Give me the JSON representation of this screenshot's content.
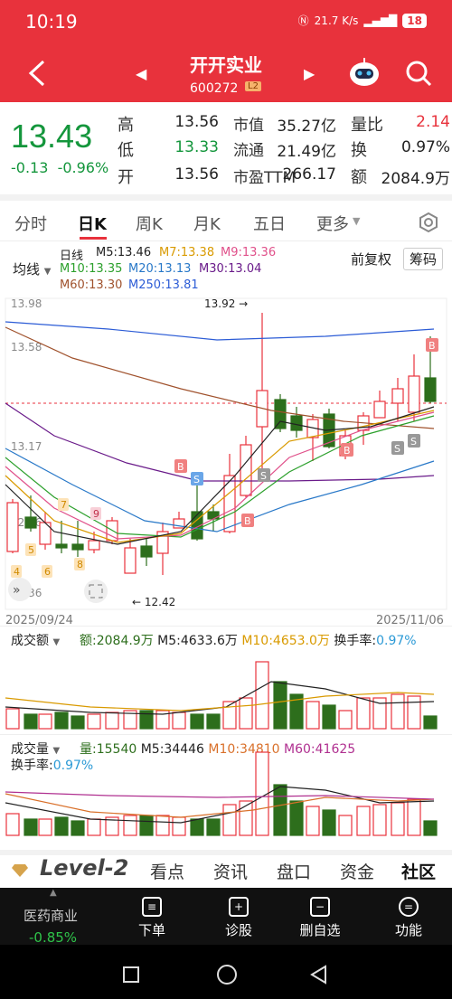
{
  "status_bar": {
    "time": "10:19",
    "net_speed": "21.7 K/s",
    "battery": "18"
  },
  "header": {
    "title": "开开实业",
    "code": "600272",
    "level_badge": "L2"
  },
  "quote": {
    "price": "13.43",
    "change": "-0.13",
    "change_pct": "-0.96%",
    "rows": [
      {
        "l1": "高",
        "v1": "13.56",
        "l2": "市值",
        "v2": "35.27亿",
        "l3": "量比",
        "v3": "2.14"
      },
      {
        "l1": "低",
        "v1": "13.33",
        "l2": "流通",
        "v2": "21.49亿",
        "l3": "换",
        "v3": "0.97%"
      },
      {
        "l1": "开",
        "v1": "13.56",
        "l2": "市盈TTM",
        "v2": "266.17",
        "l3": "额",
        "v3": "2084.9万"
      }
    ]
  },
  "tabs": [
    "分时",
    "日K",
    "周K",
    "月K",
    "五日",
    "更多"
  ],
  "active_tab": "日K",
  "ma_legend": {
    "selector": "均线",
    "period": "日线",
    "items": [
      {
        "text": "M5:13.46",
        "color": "#222222"
      },
      {
        "text": "M7:13.38",
        "color": "#d99a00"
      },
      {
        "text": "M9:13.36",
        "color": "#e0508a"
      },
      {
        "text": "M10:13.35",
        "color": "#2ca02c"
      },
      {
        "text": "M20:13.13",
        "color": "#2878c8"
      },
      {
        "text": "M30:13.04",
        "color": "#6a1b8a"
      },
      {
        "text": "M60:13.30",
        "color": "#a0522d"
      },
      {
        "text": "M250:13.81",
        "color": "#2c5cd6"
      }
    ],
    "adjust": "前复权",
    "chips": "筹码"
  },
  "kline": {
    "y_labels": [
      "13.98",
      "13.58",
      "13.17",
      "12.76",
      "12.36"
    ],
    "high_marker": "13.92",
    "low_marker": "12.42",
    "date_start": "2025/09/24",
    "date_end": "2025/11/06",
    "seq_markers": [
      "4",
      "5",
      "6",
      "7",
      "8",
      "9"
    ],
    "signals": [
      "B",
      "S",
      "B",
      "S",
      "B",
      "B",
      "S",
      "S"
    ]
  },
  "volume_amount": {
    "selector": "成交额",
    "amount": "额:2084.9万",
    "m5": "M5:4633.6万",
    "m10": "M10:4653.0万",
    "turnover_label": "换手率:",
    "turnover": "0.97%"
  },
  "volume_qty": {
    "selector": "成交量",
    "qty": "量:15540",
    "m5": "M5:34446",
    "m10": "M10:34810",
    "m60": "M60:41625",
    "turnover_label": "换手率:",
    "turnover": "0.97%"
  },
  "level2_bar": {
    "brand": "Level-2",
    "items": [
      "看点",
      "资讯",
      "盘口",
      "资金",
      "社区"
    ]
  },
  "bottom_nav": {
    "sector_name": "医药商业",
    "sector_change": "-0.85%",
    "items": [
      "下单",
      "诊股",
      "删自选",
      "功能"
    ]
  },
  "colors": {
    "up": "#e8323c",
    "down": "#2d6e1c",
    "header": "#e8323c"
  }
}
